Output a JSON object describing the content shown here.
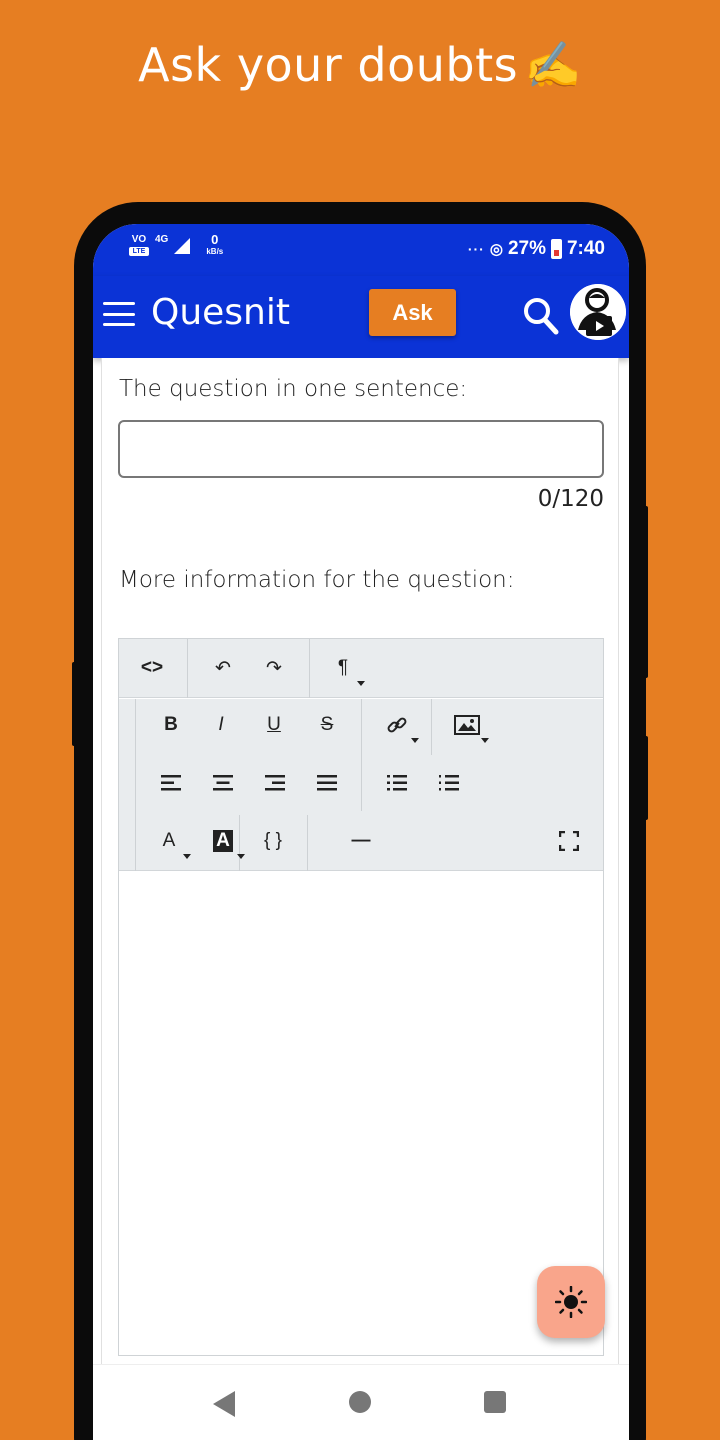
{
  "promo": {
    "headline": "Ask your doubts",
    "emoji": "✍️"
  },
  "status_bar": {
    "volte": "VO",
    "lte": "LTE",
    "network": "4G",
    "speed_value": "0",
    "speed_unit": "kB/s",
    "overflow": "···",
    "battery": "27%",
    "time": "7:40"
  },
  "app_bar": {
    "title": "Quesnit",
    "ask_label": "Ask",
    "menu_icon": "hamburger-menu-icon",
    "search_icon": "search-icon",
    "avatar_icon": "user-avatar-play-icon"
  },
  "form": {
    "question_label": "The question in one sentence:",
    "question_value": "",
    "char_counter": "0/120",
    "details_label": "More information for the question:"
  },
  "editor_toolbar": {
    "code_view": "<>",
    "undo": "↶",
    "redo": "↷",
    "paragraph": "¶",
    "bold": "B",
    "italic": "I",
    "underline": "U",
    "strikethrough": "S",
    "font_color": "A",
    "highlight": "A",
    "code_block": "{ }",
    "horizontal_rule": "—"
  },
  "colors": {
    "background": "#E67E22",
    "app_bar": "#0B33D6",
    "ask_button": "#E67E22",
    "fab": "#F9A58B"
  },
  "fab": {
    "icon": "brightness-icon"
  },
  "nav_bar": {
    "back_icon": "back-triangle-icon",
    "home_icon": "home-circle-icon",
    "recents_icon": "recents-square-icon"
  }
}
